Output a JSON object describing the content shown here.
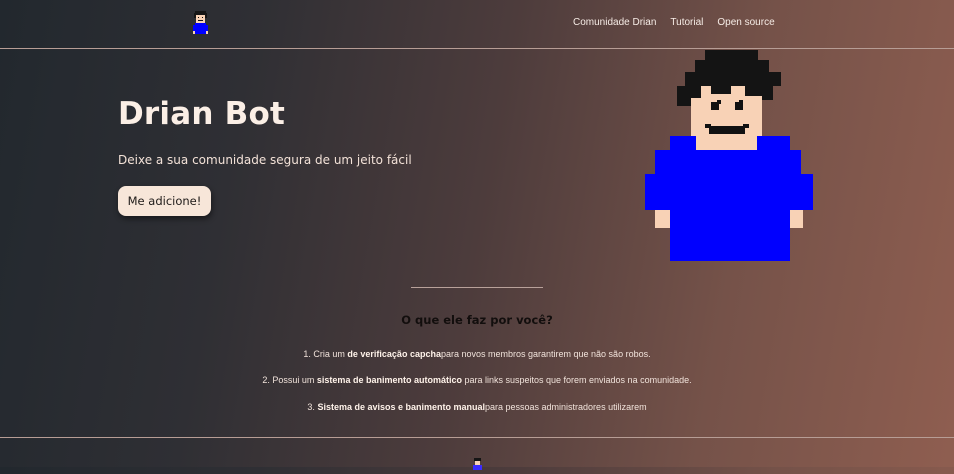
{
  "nav": {
    "links": [
      "Comunidade Drian",
      "Tutorial",
      "Open source"
    ],
    "logo_icon": "pixel-avatar-icon"
  },
  "hero": {
    "title": "Drian Bot",
    "subtitle": "Deixe a sua comunidade segura de um jeito fácil",
    "button": "Me adicione!",
    "avatar_icon": "pixel-avatar-icon"
  },
  "features": {
    "title": "O que ele faz por você?",
    "items": [
      {
        "prefix": "1. Cria um ",
        "bold": "de verificação capcha",
        "suffix": "para novos membros garantirem que não são robos."
      },
      {
        "prefix": "2. Possui um ",
        "bold": "sistema de banimento automático",
        "suffix": " para links suspeitos que forem enviados na comunidade."
      },
      {
        "prefix": "3. ",
        "bold": "Sistema de avisos e banimento manual",
        "suffix": "para pessoas administradores utilizarem"
      }
    ]
  },
  "colors": {
    "background_start": "#22282e",
    "background_end": "#8f5e50",
    "button_bg": "#f7e6d9",
    "avatar_shirt": "#0000ff",
    "avatar_skin": "#f8d2b6",
    "avatar_hair": "#111111"
  }
}
